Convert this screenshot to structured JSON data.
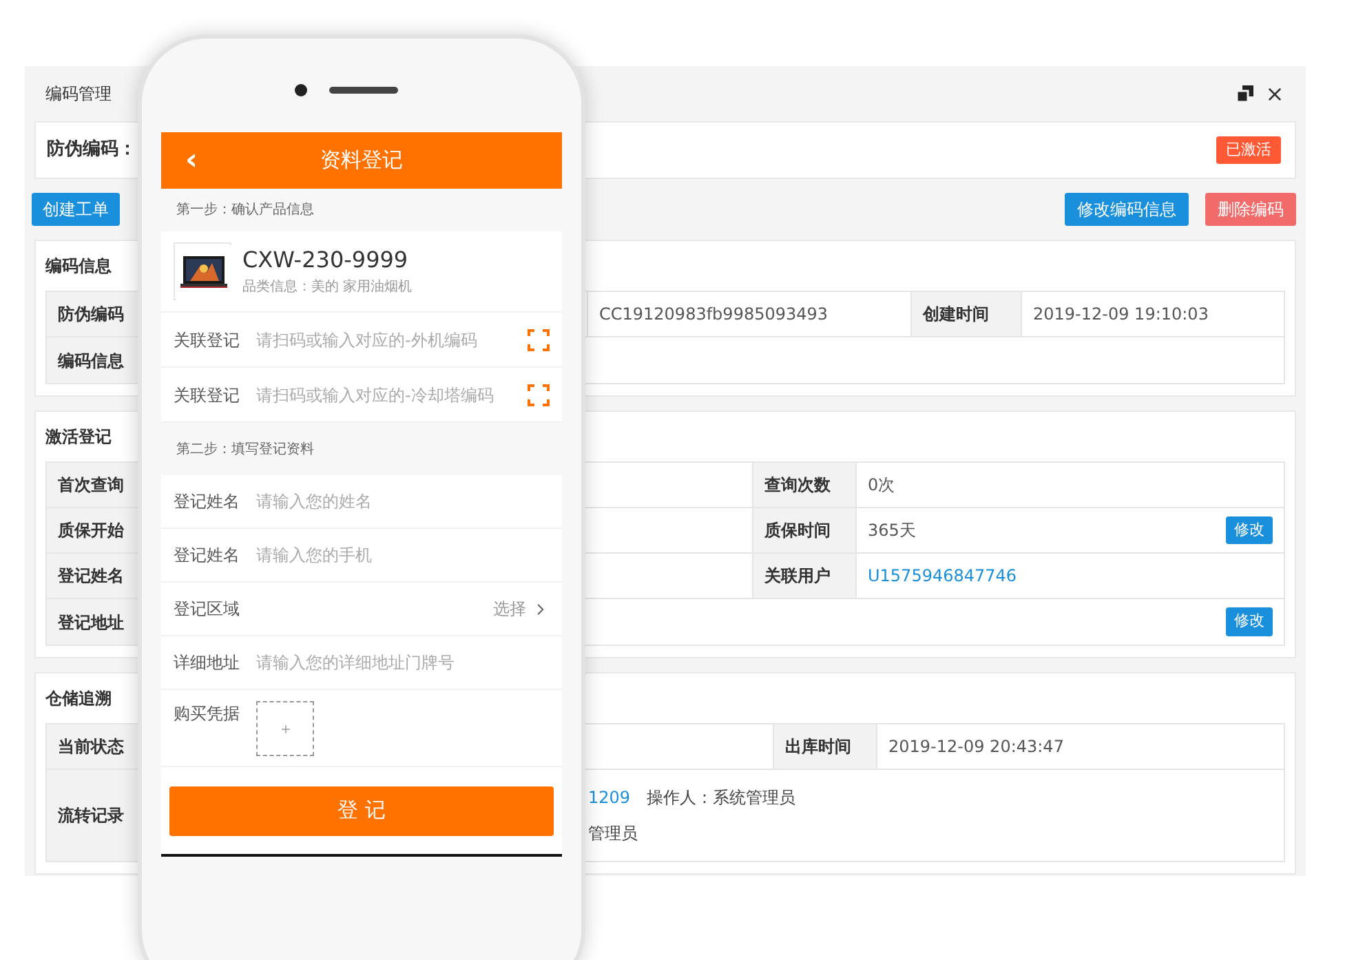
{
  "window": {
    "title": "编码管理"
  },
  "code_bar": {
    "label": "防伪编码：",
    "status": "已激活"
  },
  "actions": {
    "left": [
      {
        "label": "创建工单",
        "kind": "primary"
      }
    ],
    "right": [
      {
        "label": "修改编码信息",
        "kind": "primary"
      },
      {
        "label": "删除编码",
        "kind": "danger"
      }
    ]
  },
  "sections": [
    {
      "title": "编码信息",
      "rows": [
        {
          "label": "防伪编码",
          "mid": "CC19120983fb9985093493",
          "label_2": "创建时间",
          "value_2": "2019-12-09 19:10:03"
        },
        {
          "label": "编码信息"
        }
      ]
    },
    {
      "title": "激活登记",
      "rows": [
        {
          "label": "首次查询",
          "label_2": "查询次数",
          "value_2": "0次"
        },
        {
          "label": "质保开始",
          "label_2": "质保时间",
          "value_2": "365天",
          "action": "修改"
        },
        {
          "label": "登记姓名",
          "label_2": "关联用户",
          "value_2": "U1575946847746",
          "kind": "link"
        },
        {
          "label": "登记地址",
          "action": "修改"
        }
      ]
    },
    {
      "title": "仓储追溯",
      "rows": [
        {
          "label": "当前状态",
          "label_2": "出库时间",
          "value_2": "2019-12-09 20:43:47"
        },
        {
          "label": "流转记录",
          "lines": [
            {
              "parts": [
                {
                  "text": "1209",
                  "kind": "link"
                },
                {
                  "text": "操作人：系统管理员",
                  "kind": "text"
                }
              ]
            },
            {
              "parts": [
                {
                  "text": "管理员",
                  "kind": "text"
                }
              ]
            }
          ]
        }
      ]
    }
  ],
  "phone": {
    "title": "资料登记",
    "back": "‹",
    "step_1": "第一步：确认产品信息",
    "product": {
      "model": "CXW-230-9999",
      "category": "品类信息：美的 家用油烟机"
    },
    "links": [
      {
        "label": "关联登记",
        "placeholder": "请扫码或输入对应的-外机编码"
      },
      {
        "label": "关联登记",
        "placeholder": "请扫码或输入对应的-冷却塔编码"
      }
    ],
    "step_2": "第二步：填写登记资料",
    "fields": [
      {
        "kind": "input",
        "label": "登记姓名",
        "placeholder": "请输入您的姓名"
      },
      {
        "kind": "input",
        "label": "登记姓名",
        "placeholder": "请输入您的手机"
      },
      {
        "kind": "select",
        "label": "登记区域",
        "value": "选择"
      },
      {
        "kind": "input",
        "label": "详细地址",
        "placeholder": "请输入您的详细地址门牌号"
      },
      {
        "kind": "upload",
        "label": "购买凭据"
      }
    ],
    "submit": "登 记"
  }
}
